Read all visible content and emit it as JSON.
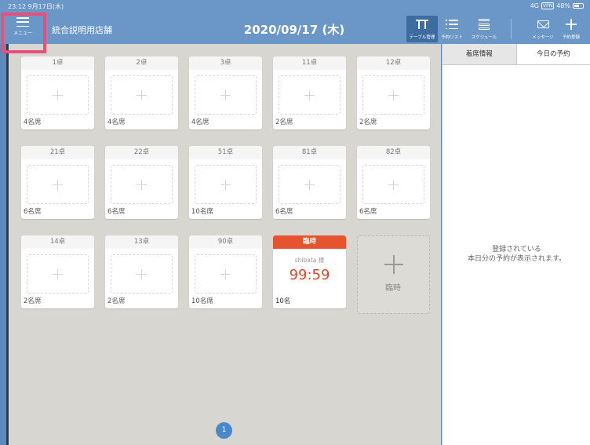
{
  "status_bar": {
    "time": "23:12 9月17日(木)",
    "signal": "4G",
    "vpn": "VPN",
    "battery": "48%"
  },
  "header": {
    "menu_label": "メニュー",
    "store_name": "統合説明用店舗",
    "date": "2020/09/17 (木)",
    "buttons": {
      "table": "テーブル管理",
      "list": "予約リスト",
      "schedule": "スケジュール",
      "message": "メッセージ",
      "register": "予約登録"
    }
  },
  "tables": [
    {
      "name": "1卓",
      "seats": "4名席"
    },
    {
      "name": "2卓",
      "seats": "4名席"
    },
    {
      "name": "3卓",
      "seats": "4名席"
    },
    {
      "name": "11卓",
      "seats": "2名席"
    },
    {
      "name": "12卓",
      "seats": "2名席"
    },
    {
      "name": "21卓",
      "seats": "6名席"
    },
    {
      "name": "22卓",
      "seats": "6名席"
    },
    {
      "name": "51卓",
      "seats": "10名席"
    },
    {
      "name": "81卓",
      "seats": "6名席"
    },
    {
      "name": "82卓",
      "seats": "6名席"
    },
    {
      "name": "14卓",
      "seats": "2名席"
    },
    {
      "name": "13卓",
      "seats": "2名席"
    },
    {
      "name": "90卓",
      "seats": "10名席"
    }
  ],
  "temp_table": {
    "title": "臨時",
    "guest": "shibata 様",
    "timer": "99:59",
    "seats": "10名"
  },
  "add_temp": {
    "label": "臨時"
  },
  "pagination": {
    "current": "1"
  },
  "panel": {
    "tab_seating": "着席情報",
    "tab_today": "今日の予約",
    "empty_line1": "登録されている",
    "empty_line2": "本日分の予約が表示されます。"
  }
}
